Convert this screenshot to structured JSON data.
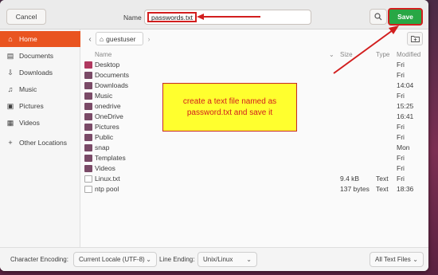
{
  "header": {
    "cancel_label": "Cancel",
    "name_label": "Name",
    "filename_value": "passwords.txt",
    "save_label": "Save"
  },
  "sidebar": {
    "items": [
      {
        "label": "Home",
        "icon": "home-icon",
        "active": true
      },
      {
        "label": "Documents",
        "icon": "document-icon"
      },
      {
        "label": "Downloads",
        "icon": "download-icon"
      },
      {
        "label": "Music",
        "icon": "music-icon"
      },
      {
        "label": "Pictures",
        "icon": "picture-icon"
      },
      {
        "label": "Videos",
        "icon": "video-icon"
      },
      {
        "label": "Other Locations",
        "icon": "plus-icon"
      }
    ]
  },
  "pathbar": {
    "current": "guestuser"
  },
  "list": {
    "columns": {
      "name": "Name",
      "size": "Size",
      "type": "Type",
      "modified": "Modified"
    },
    "rows": [
      {
        "name": "Desktop",
        "size": "",
        "type": "",
        "modified": "Fri",
        "kind": "folder"
      },
      {
        "name": "Documents",
        "size": "",
        "type": "",
        "modified": "Fri",
        "kind": "folder"
      },
      {
        "name": "Downloads",
        "size": "",
        "type": "",
        "modified": "14:04",
        "kind": "folder"
      },
      {
        "name": "Music",
        "size": "",
        "type": "",
        "modified": "Fri",
        "kind": "folder"
      },
      {
        "name": "onedrive",
        "size": "",
        "type": "",
        "modified": "15:25",
        "kind": "folder"
      },
      {
        "name": "OneDrive",
        "size": "",
        "type": "",
        "modified": "16:41",
        "kind": "folder"
      },
      {
        "name": "Pictures",
        "size": "",
        "type": "",
        "modified": "Fri",
        "kind": "folder"
      },
      {
        "name": "Public",
        "size": "",
        "type": "",
        "modified": "Fri",
        "kind": "folder"
      },
      {
        "name": "snap",
        "size": "",
        "type": "",
        "modified": "Mon",
        "kind": "folder"
      },
      {
        "name": "Templates",
        "size": "",
        "type": "",
        "modified": "Fri",
        "kind": "folder"
      },
      {
        "name": "Videos",
        "size": "",
        "type": "",
        "modified": "Fri",
        "kind": "folder"
      },
      {
        "name": "Linux.txt",
        "size": "9.4 kB",
        "type": "Text",
        "modified": "Fri",
        "kind": "file"
      },
      {
        "name": "ntp pool",
        "size": "137 bytes",
        "type": "Text",
        "modified": "18:36",
        "kind": "file"
      }
    ]
  },
  "annotation": {
    "text": "create a text file named as password.txt and save it"
  },
  "footer": {
    "encoding_label": "Character Encoding:",
    "encoding_value": "Current Locale (UTF-8)",
    "line_ending_label": "Line Ending:",
    "line_ending_value": "Unix/Linux",
    "filter_value": "All Text Files"
  },
  "colors": {
    "accent": "#e95420",
    "save_green": "#28a745",
    "highlight_red": "#d21e1e",
    "note_yellow": "#ffff2e"
  }
}
